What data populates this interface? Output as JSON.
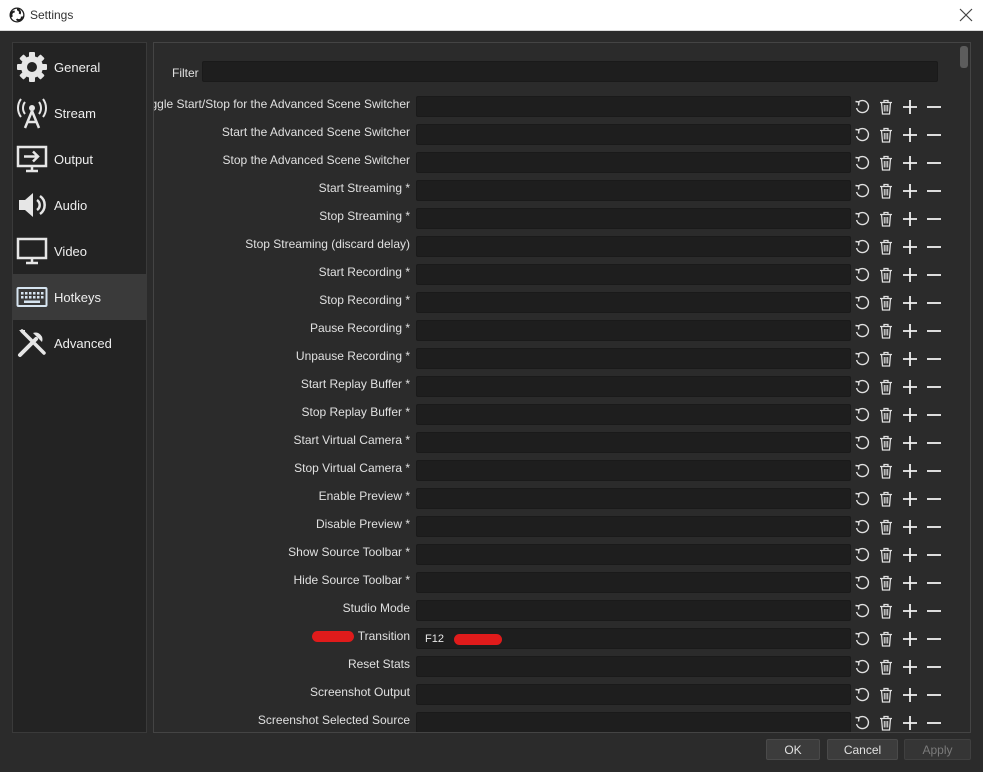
{
  "window": {
    "title": "Settings"
  },
  "sidebar": {
    "items": [
      {
        "label": "General",
        "icon": "gear-icon"
      },
      {
        "label": "Stream",
        "icon": "broadcast-antenna-icon"
      },
      {
        "label": "Output",
        "icon": "monitor-output-icon"
      },
      {
        "label": "Audio",
        "icon": "speaker-icon"
      },
      {
        "label": "Video",
        "icon": "monitor-icon"
      },
      {
        "label": "Hotkeys",
        "icon": "keyboard-icon",
        "active": true
      },
      {
        "label": "Advanced",
        "icon": "tools-icon"
      }
    ]
  },
  "hotkeys": {
    "filter_label": "Filter",
    "filter_value": "",
    "rows": [
      {
        "label": "Toggle Start/Stop for the Advanced Scene Switcher",
        "key": ""
      },
      {
        "label": "Start the Advanced Scene Switcher",
        "key": ""
      },
      {
        "label": "Stop the Advanced Scene Switcher",
        "key": ""
      },
      {
        "label": "Start Streaming *",
        "key": ""
      },
      {
        "label": "Stop Streaming *",
        "key": ""
      },
      {
        "label": "Stop Streaming (discard delay)",
        "key": ""
      },
      {
        "label": "Start Recording *",
        "key": ""
      },
      {
        "label": "Stop Recording *",
        "key": ""
      },
      {
        "label": "Pause Recording *",
        "key": ""
      },
      {
        "label": "Unpause Recording *",
        "key": ""
      },
      {
        "label": "Start Replay Buffer *",
        "key": ""
      },
      {
        "label": "Stop Replay Buffer *",
        "key": ""
      },
      {
        "label": "Start Virtual Camera *",
        "key": ""
      },
      {
        "label": "Stop Virtual Camera *",
        "key": ""
      },
      {
        "label": "Enable Preview *",
        "key": ""
      },
      {
        "label": "Disable Preview *",
        "key": ""
      },
      {
        "label": "Show Source Toolbar *",
        "key": ""
      },
      {
        "label": "Hide Source Toolbar *",
        "key": ""
      },
      {
        "label": "Studio Mode",
        "key": ""
      },
      {
        "label": "Transition",
        "key": "F12",
        "redacted": true
      },
      {
        "label": "Reset Stats",
        "key": ""
      },
      {
        "label": "Screenshot Output",
        "key": ""
      },
      {
        "label": "Screenshot Selected Source",
        "key": ""
      }
    ]
  },
  "buttons": {
    "ok": "OK",
    "cancel": "Cancel",
    "apply": "Apply"
  },
  "colors": {
    "background": "#2b2b2b",
    "field": "#1e1e1e",
    "redaction": "#e01b1b",
    "active_item": "#3a3a3a"
  }
}
